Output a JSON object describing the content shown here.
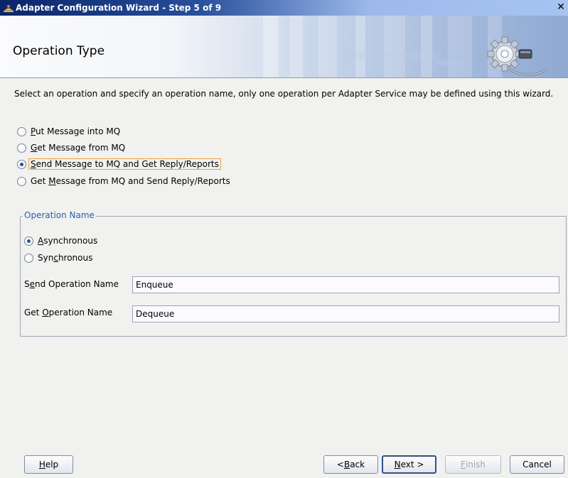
{
  "window": {
    "title": "Adapter Configuration Wizard - Step 5 of 9",
    "close_glyph": "✕"
  },
  "header": {
    "title": "Operation Type",
    "binary_text": "010101010101010101010101",
    "binary_text2": "01010101010"
  },
  "instructions": "Select an operation and specify an operation name, only one operation per Adapter Service may be defined using this wizard.",
  "operations": [
    {
      "pre": "",
      "mnemonic": "P",
      "post": "ut Message into MQ",
      "checked": false
    },
    {
      "pre": "",
      "mnemonic": "G",
      "post": "et Message from MQ",
      "checked": false
    },
    {
      "pre": "",
      "mnemonic": "S",
      "post": "end Message to MQ and Get Reply/Reports",
      "checked": true
    },
    {
      "pre": "Get ",
      "mnemonic": "M",
      "post": "essage from MQ and Send Reply/Reports",
      "checked": false
    }
  ],
  "operation_name": {
    "legend": "Operation Name",
    "modes": [
      {
        "pre": "",
        "mnemonic": "A",
        "post": "synchronous",
        "checked": true
      },
      {
        "pre": "Syn",
        "mnemonic": "c",
        "post": "hronous",
        "checked": false
      }
    ],
    "send": {
      "pre": "S",
      "mnemonic": "e",
      "post": "nd Operation Name",
      "value": "Enqueue"
    },
    "get": {
      "pre": "Get ",
      "mnemonic": "O",
      "post": "peration Name",
      "value": "Dequeue"
    }
  },
  "buttons": {
    "help": {
      "pre": "",
      "mnemonic": "H",
      "post": "elp"
    },
    "back": {
      "pre": "< ",
      "mnemonic": "B",
      "post": "ack"
    },
    "next": {
      "pre": "",
      "mnemonic": "N",
      "post": "ext >"
    },
    "finish": {
      "pre": "",
      "mnemonic": "F",
      "post": "inish"
    },
    "cancel": {
      "pre": "Cancel",
      "mnemonic": "",
      "post": ""
    }
  },
  "colors": {
    "title_bar": "#0a246a",
    "legend": "#2a5db0",
    "focus": "#e9a13c"
  }
}
